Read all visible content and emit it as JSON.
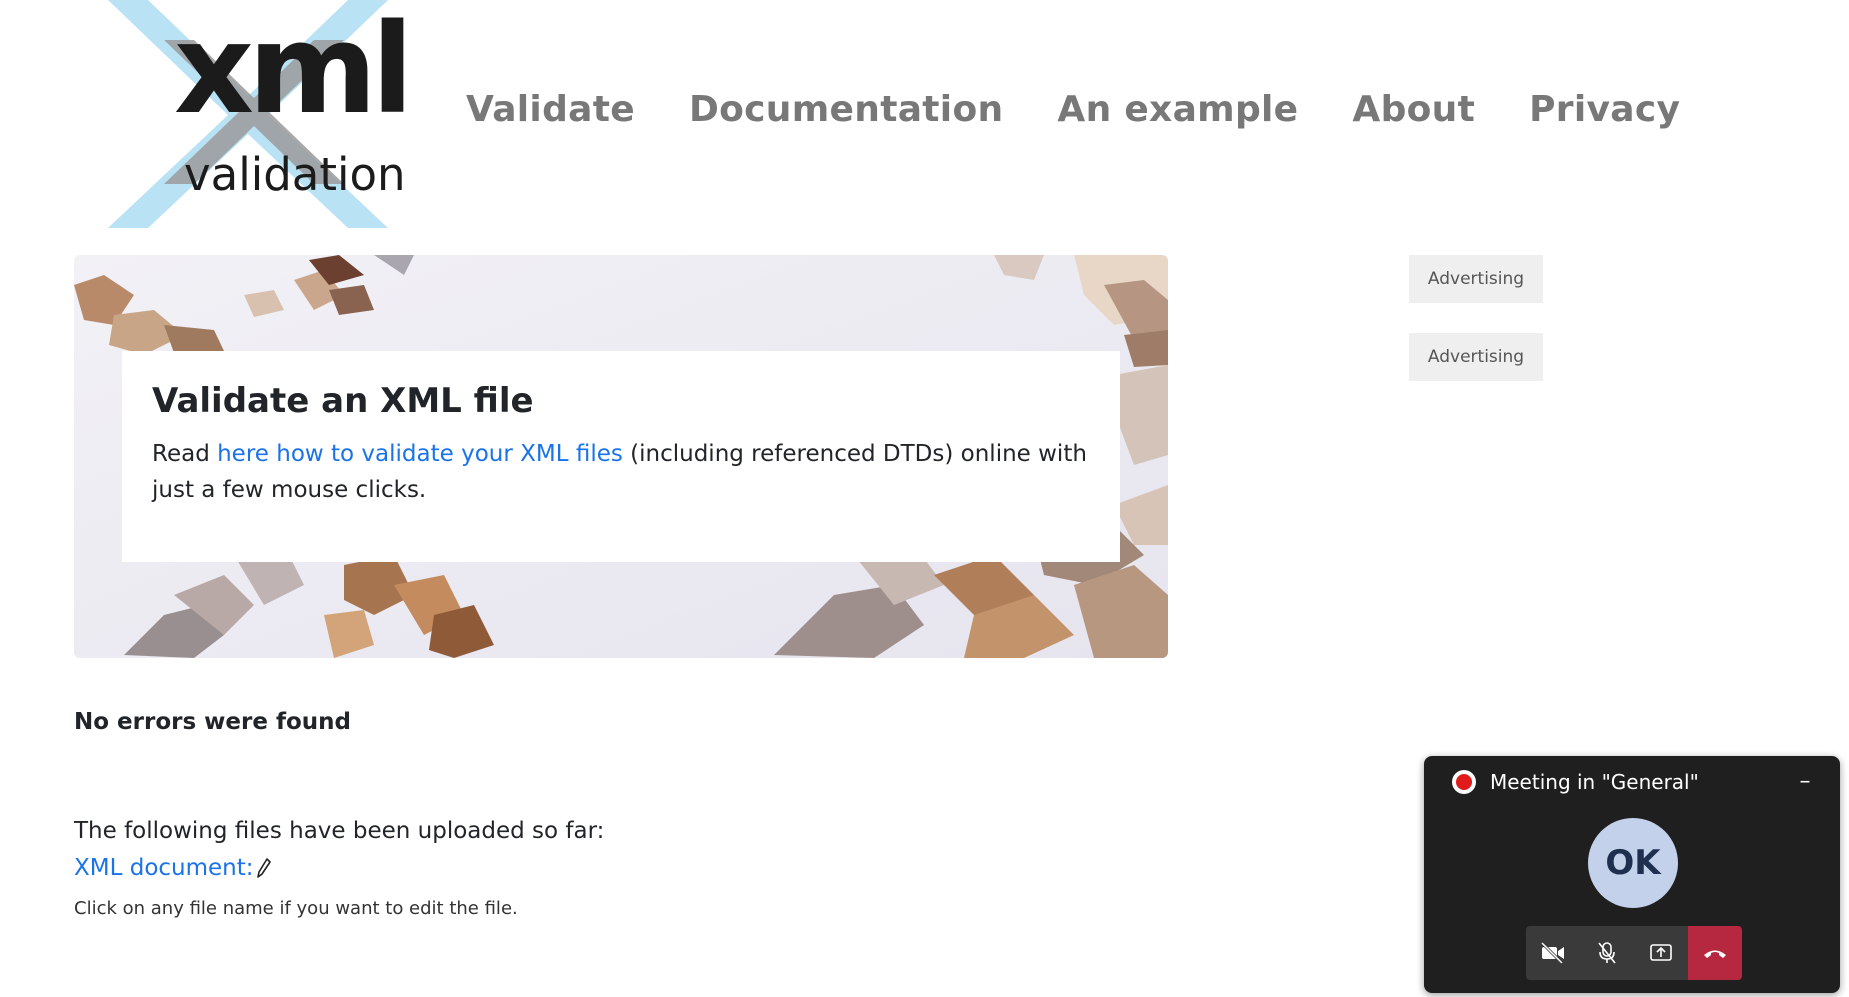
{
  "header": {
    "logo": {
      "primary_text": "xml",
      "secondary_text": "validation"
    },
    "nav": [
      {
        "label": "Validate"
      },
      {
        "label": "Documentation"
      },
      {
        "label": "An example"
      },
      {
        "label": "About"
      },
      {
        "label": "Privacy"
      }
    ]
  },
  "hero": {
    "title": "Validate an XML file",
    "text_before_link": "Read ",
    "link_text": "here how to validate your XML files",
    "text_after_link": " (including referenced DTDs) online with just a few mouse clicks."
  },
  "ads": [
    {
      "label": "Advertising"
    },
    {
      "label": "Advertising"
    }
  ],
  "result": {
    "status": "No errors were found",
    "uploaded_intro": "The following files have been uploaded so far:",
    "file_link": "XML document:",
    "hint": "Click on any file name if you want to edit the file."
  },
  "meeting": {
    "title": "Meeting in \"General\"",
    "avatar_initials": "OK",
    "controls": [
      "camera-off-icon",
      "mic-off-icon",
      "share-screen-icon",
      "hang-up-icon"
    ]
  },
  "colors": {
    "link": "#1a73e8",
    "nav": "#787878",
    "hang_up": "#b5283f",
    "logo_cross": "#b9e2f5"
  }
}
